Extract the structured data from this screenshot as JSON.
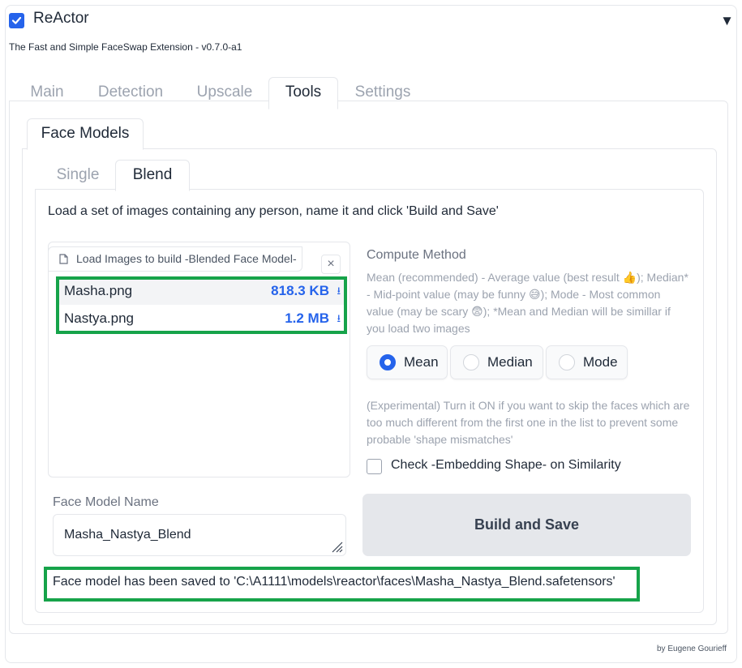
{
  "app": {
    "title": "ReActor",
    "enabled": true,
    "subtitle": "The Fast and Simple FaceSwap Extension - v0.7.0-a1",
    "collapse_icon": "triangle-down-icon",
    "footer": "by Eugene Gourieff"
  },
  "tabs": [
    {
      "label": "Main",
      "active": false
    },
    {
      "label": "Detection",
      "active": false
    },
    {
      "label": "Upscale",
      "active": false
    },
    {
      "label": "Tools",
      "active": true
    },
    {
      "label": "Settings",
      "active": false
    }
  ],
  "tools": {
    "tab_label": "Face Models",
    "subtabs": [
      {
        "label": "Single",
        "active": false
      },
      {
        "label": "Blend",
        "active": true
      }
    ]
  },
  "blend": {
    "instructions": "Load a set of images containing any person, name it and click 'Build and Save'",
    "uploader": {
      "label": "Load Images to build -Blended Face Model-",
      "clear_icon": "×",
      "files": [
        {
          "name": "Masha.png",
          "size": "818.3 KB"
        },
        {
          "name": "Nastya.png",
          "size": "1.2 MB"
        }
      ]
    },
    "compute_method": {
      "label": "Compute Method",
      "info": "Mean (recommended) - Average value (best result 👍); Median* - Mid-point value (may be funny 😅); Mode - Most common value (may be scary 😨); *Mean and Median will be simillar if you load two images",
      "options": [
        "Mean",
        "Median",
        "Mode"
      ],
      "selected": "Mean"
    },
    "experimental": {
      "info": "(Experimental) Turn it ON if you want to skip the faces which are too much different from the first one in the list to prevent some probable 'shape mismatches'",
      "checkbox_label": "Check -Embedding Shape- on Similarity",
      "checked": false
    },
    "model_name": {
      "label": "Face Model Name",
      "value": "Masha_Nastya_Blend"
    },
    "build_button": "Build and Save",
    "status": "Face model has been saved to 'C:\\A1111\\models\\reactor\\faces\\Masha_Nastya_Blend.safetensors'"
  },
  "colors": {
    "accent": "#2563eb",
    "highlight": "#16a34a"
  }
}
